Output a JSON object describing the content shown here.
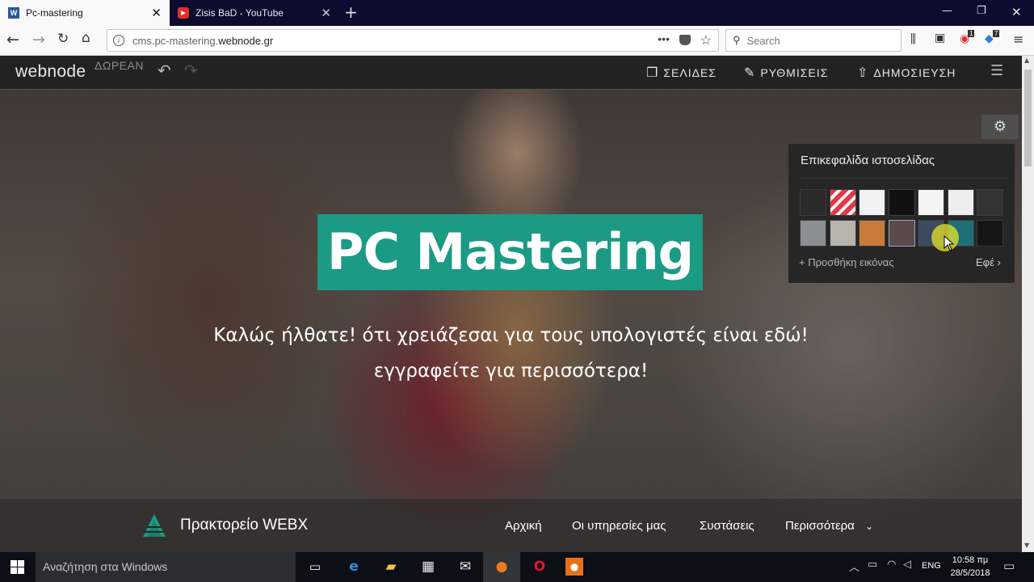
{
  "browser": {
    "tabs": [
      {
        "title": "Pc-mastering",
        "favicon": "W",
        "active": true
      },
      {
        "title": "Zisis BaD - YouTube",
        "favicon": "▶",
        "active": false
      }
    ],
    "url_prefix": "cms.pc-mastering.",
    "url_domain": "webnode.gr",
    "search_placeholder": "Search",
    "badges": {
      "addon1": "1",
      "addon2": "7"
    }
  },
  "editor": {
    "logo": "webnode",
    "plan": "ΔΩΡΕΑΝ",
    "pages_label": "ΣΕΛΙΔΕΣ",
    "settings_label": "ΡΥΘΜΙΣΕΙΣ",
    "publish_label": "ΔΗΜΟΣΙΕΥΣΗ"
  },
  "header_panel": {
    "title": "Επικεφαλίδα ιστοσελίδας",
    "add_image": "+ Προσθήκη εικόνας",
    "effects": "Εφέ ›",
    "row1_colors": [
      "#2a2a2a",
      "#e0394a",
      "#f2f2f2",
      "#111111",
      "#f4f4f4",
      "#eeeeee",
      "#333333"
    ],
    "row2_colors": [
      "#8b8e92",
      "#b7b4ad",
      "#c77b3a",
      "#5a4a4a",
      "#3b4a5c",
      "#1e6f75",
      "#151515"
    ]
  },
  "hero": {
    "title": "PC Mastering",
    "subtitle_line1": "Καλώς ήλθατε! ότι χρειάζεσαι για τους υπολογιστές είναι εδώ!",
    "subtitle_line2": "εγγραφείτε για περισσότερα!",
    "accent_color": "#1b9a84"
  },
  "site_nav": {
    "brand": "Πρακτορείο WEBX",
    "items": [
      "Αρχική",
      "Οι υπηρεσίες μας",
      "Συστάσεις",
      "Περισσότερα"
    ]
  },
  "taskbar": {
    "search_placeholder": "Αναζήτηση στα Windows",
    "language": "ENG",
    "time": "10:58 πμ",
    "date": "28/5/2018"
  }
}
